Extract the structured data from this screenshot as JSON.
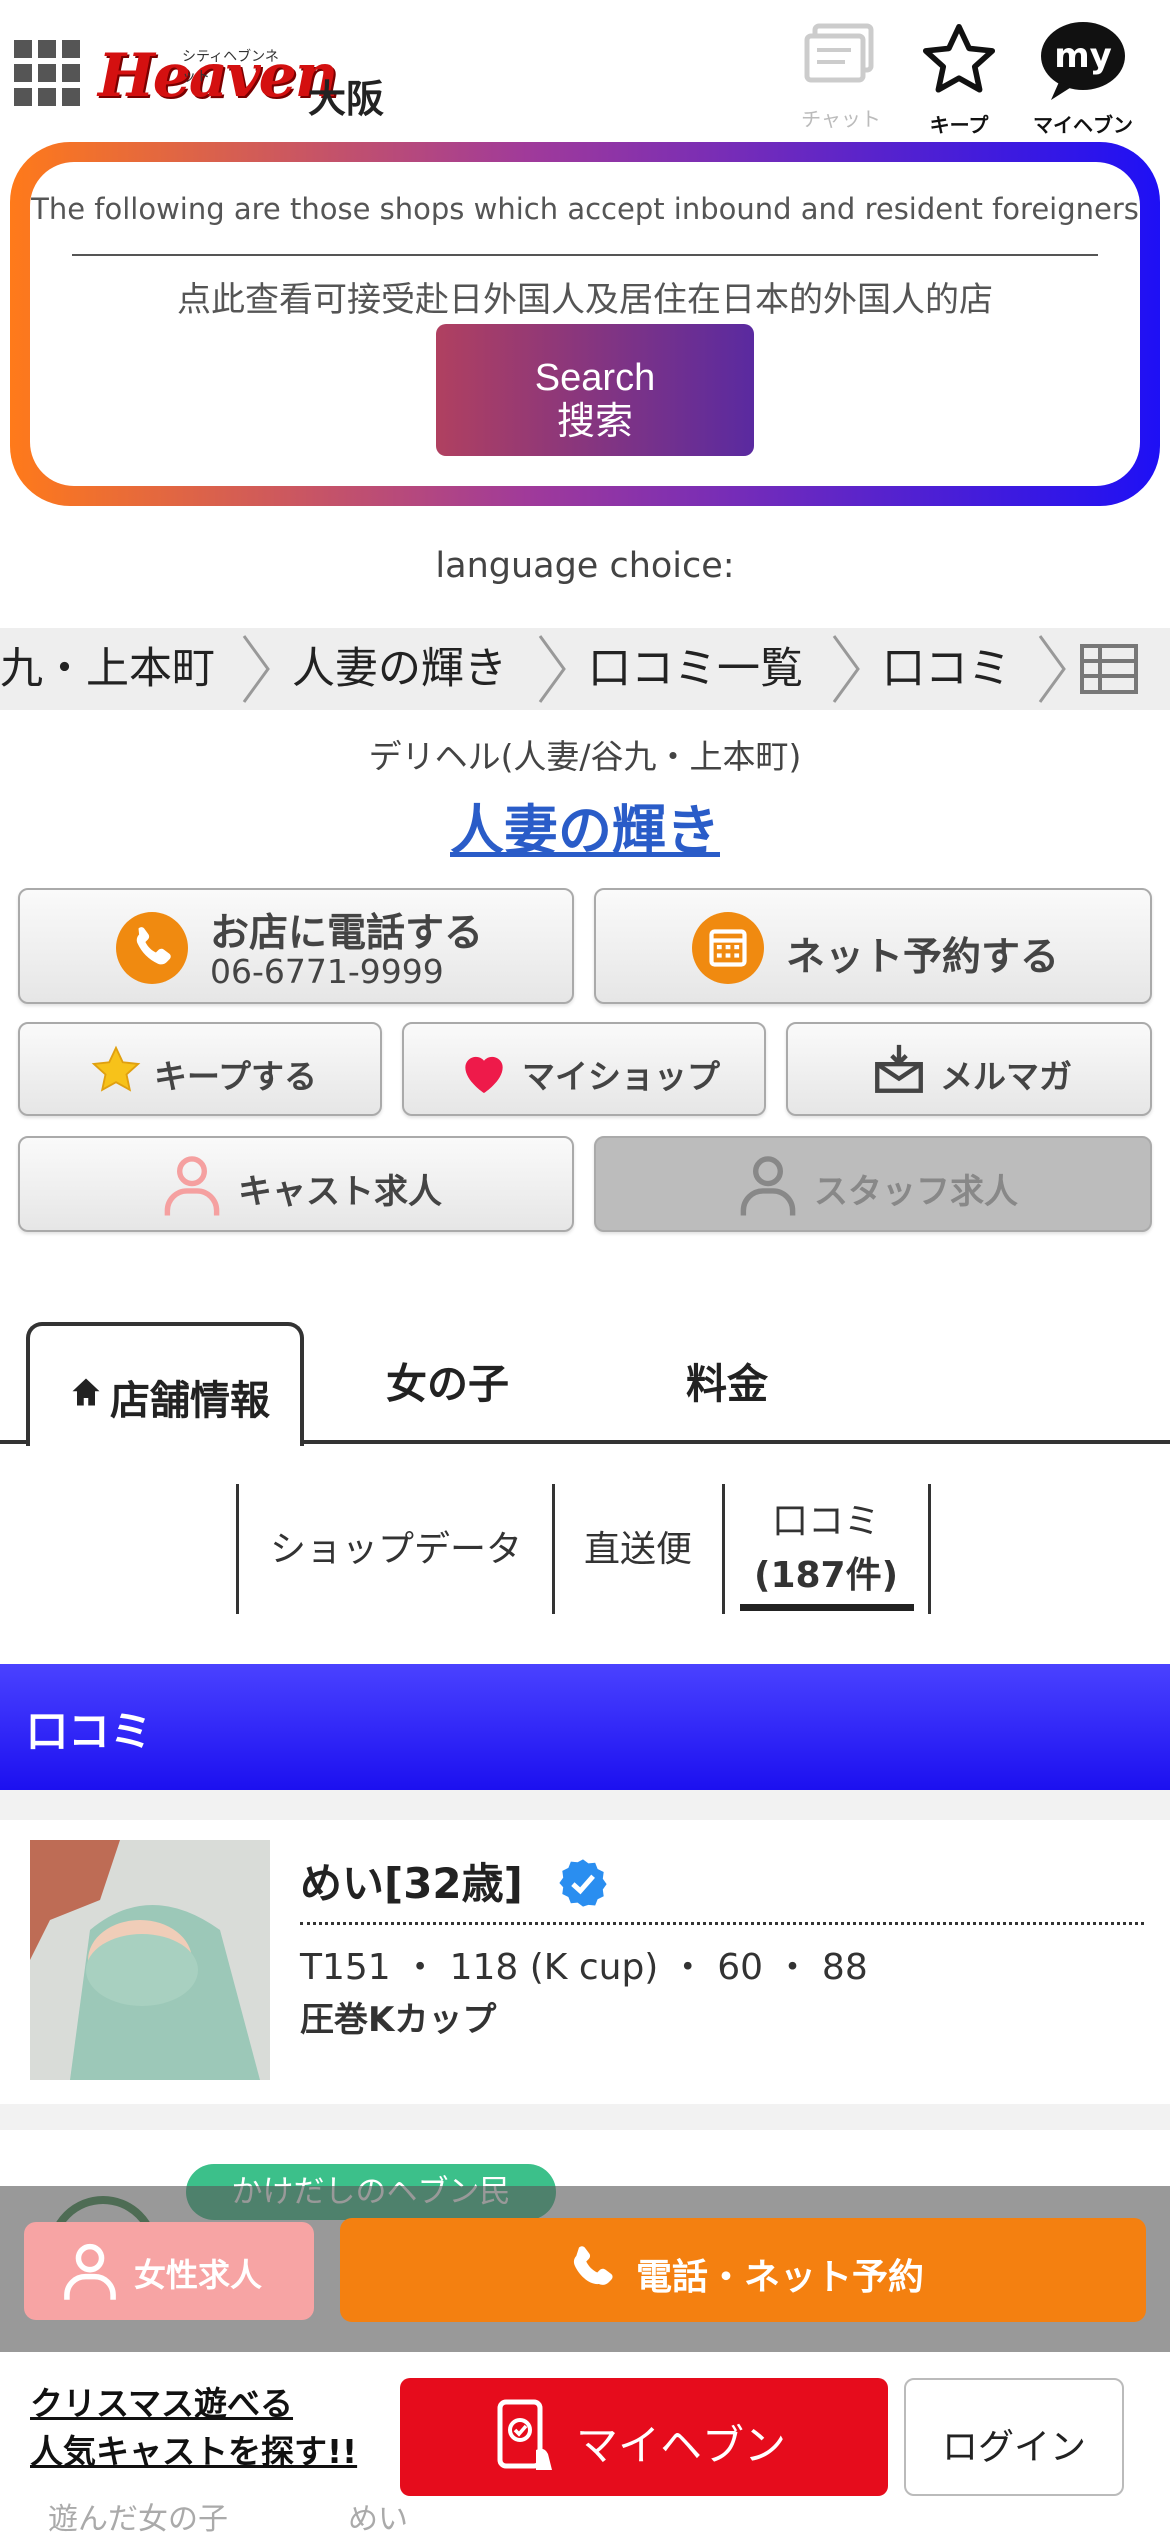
{
  "header": {
    "logo_text": "Heaven",
    "logo_sub": "シティヘブンネット",
    "region": "大阪",
    "chat_label": "チャット",
    "keep_label": "キープ",
    "myheaven_label": "マイヘブン",
    "myheaven_icon_text": "my"
  },
  "inbound": {
    "english": "The following are those shops which accept inbound and resident foreigners",
    "chinese": "点此查看可接受赴日外国人及居住在日本的外国人的店",
    "search_label_en": "Search",
    "search_label_cn": "搜索"
  },
  "language_choice": "language choice:",
  "breadcrumb": [
    "九・上本町",
    "人妻の輝き",
    "口コミ一覧",
    "口コミ"
  ],
  "shop": {
    "type": "デリヘル(人妻/谷九・上本町)",
    "name": "人妻の輝き"
  },
  "actions": {
    "call_label": "お店に電話する",
    "call_number": "06-6771-9999",
    "reserve_label": "ネット予約する",
    "keep_label": "キープする",
    "myshop_label": "マイショップ",
    "mailmag_label": "メルマガ",
    "cast_recruit_label": "キャスト求人",
    "staff_recruit_label": "スタッフ求人"
  },
  "tabs": {
    "shop_info": "店舗情報",
    "girls": "女の子",
    "price": "料金"
  },
  "subnav": {
    "shop_data": "ショップデータ",
    "direct": "直送便",
    "kuchikomi": "口コミ",
    "kuchikomi_count": "(187件)"
  },
  "section_title": "口コミ",
  "cast": {
    "name": "めい[32歳]",
    "spec": "T151 ・ 118 (K cup) ・ 60 ・ 88",
    "catch": "圧巻Kカップ"
  },
  "review_peek": {
    "badge": "かけだしのヘブン民",
    "visited_label": "遊んだ女の子",
    "visited_name": "めい"
  },
  "floating": {
    "recruit_label": "女性求人",
    "call_reserve_label": "電話・ネット予約"
  },
  "bottom": {
    "xmas_line1": "クリスマス遊べる",
    "xmas_line2": "人気キャストを探す!!",
    "myheaven_label": "マイヘブン",
    "login_label": "ログイン"
  },
  "colors": {
    "accent_orange": "#f48010",
    "section_blue": "#1c10f0",
    "link_blue": "#2a5cc8",
    "red": "#e60c1c"
  }
}
